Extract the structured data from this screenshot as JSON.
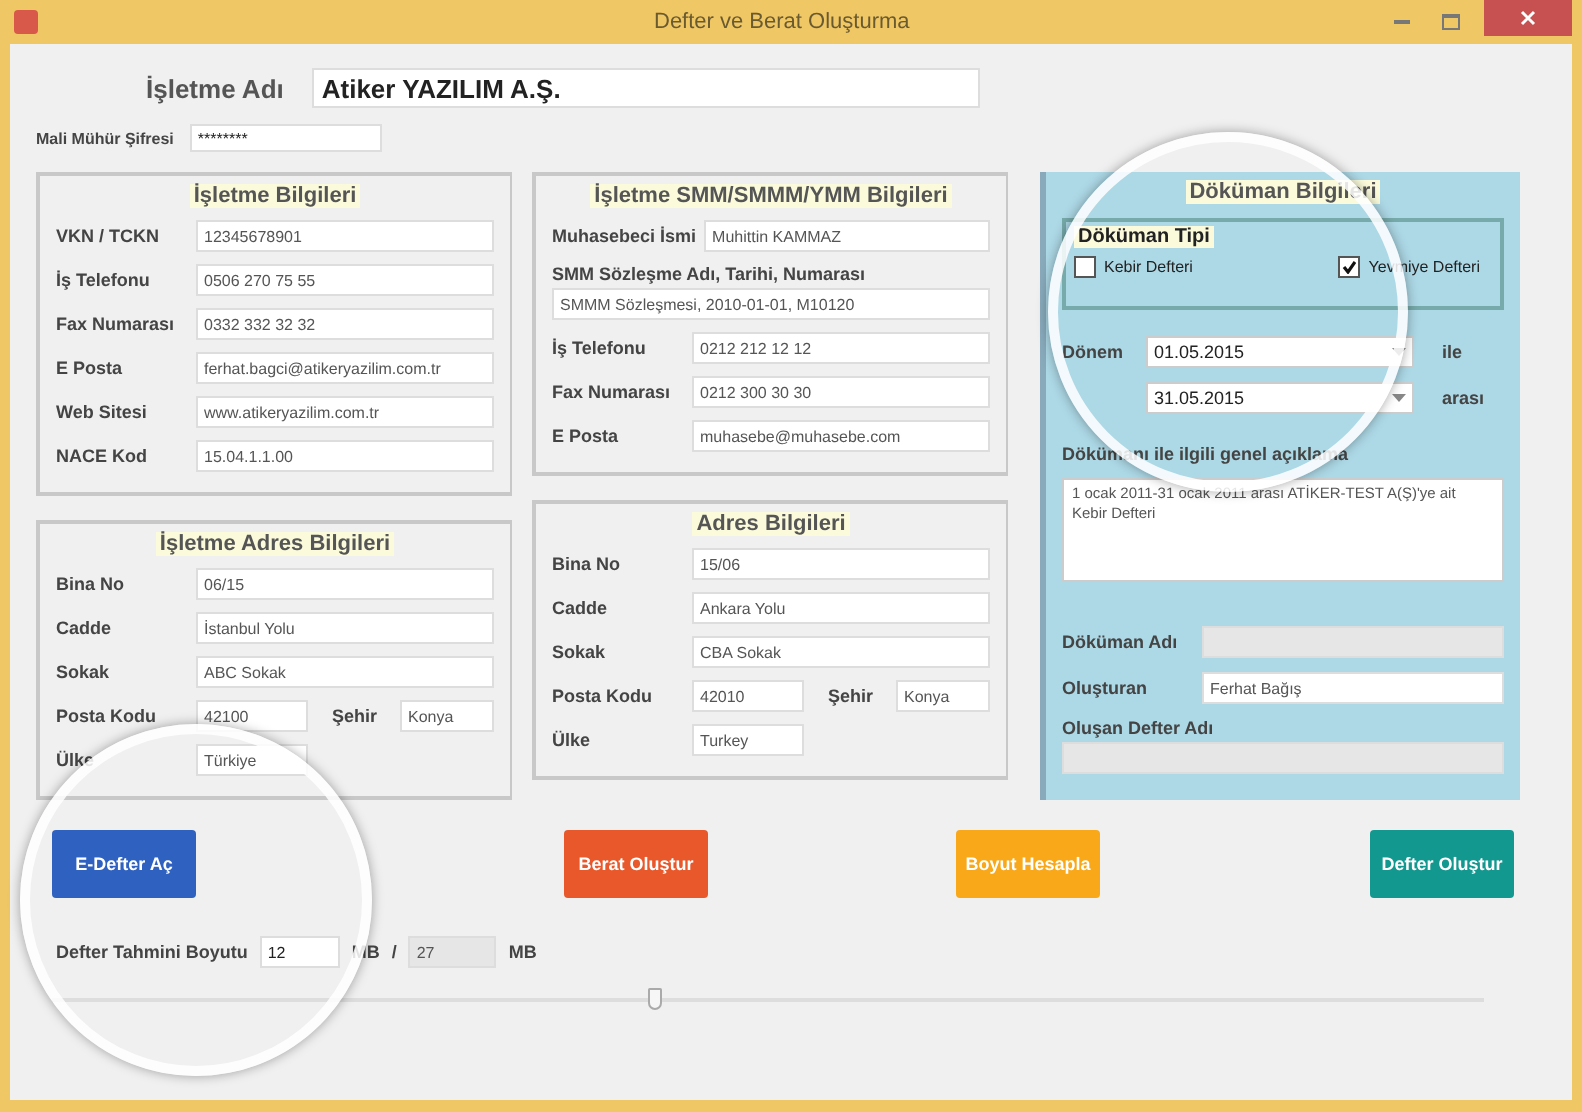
{
  "window": {
    "title": "Defter ve Berat Oluşturma"
  },
  "business_name": {
    "label": "İşletme Adı",
    "value": "Atiker YAZILIM A.Ş."
  },
  "seal_password": {
    "label": "Mali Mühür Şifresi",
    "value": "********"
  },
  "left_panels": [
    {
      "title": "İşletme Bilgileri",
      "fields": [
        {
          "kind": "inline",
          "label": "VKN / TCKN",
          "value": "12345678901"
        },
        {
          "kind": "inline",
          "label": "İş Telefonu",
          "value": "0506 270 75 55"
        },
        {
          "kind": "inline",
          "label": "Fax Numarası",
          "value": "0332 332 32 32"
        },
        {
          "kind": "inline",
          "label": "E Posta",
          "value": "ferhat.bagci@atikeryazilim.com.tr"
        },
        {
          "kind": "inline",
          "label": "Web Sitesi",
          "value": "www.atikeryazilim.com.tr"
        },
        {
          "kind": "inline",
          "label": "NACE Kod",
          "value": "15.04.1.1.00"
        }
      ]
    },
    {
      "title": "İşletme Adres Bilgileri",
      "fields": [
        {
          "kind": "inline",
          "label": "Bina No",
          "value": "06/15"
        },
        {
          "kind": "inline",
          "label": "Cadde",
          "value": "İstanbul Yolu"
        },
        {
          "kind": "inline",
          "label": "Sokak",
          "value": "ABC Sokak"
        },
        {
          "kind": "pair",
          "label": "Posta Kodu",
          "value": "42100",
          "label2": "Şehir",
          "value2": "Konya"
        },
        {
          "kind": "short",
          "label": "Ülke",
          "value": "Türkiye"
        }
      ]
    }
  ],
  "middle_panels": [
    {
      "title": "İşletme SMM/SMMM/YMM Bilgileri",
      "fields": [
        {
          "kind": "inline",
          "label": "Muhasebeci İsmi",
          "value": "Muhittin KAMMAZ"
        },
        {
          "kind": "stacked",
          "label": "SMM Sözleşme Adı, Tarihi, Numarası",
          "value": "SMMM Sözleşmesi, 2010-01-01, M10120"
        },
        {
          "kind": "inline",
          "label": "İş Telefonu",
          "value": "0212 212 12 12"
        },
        {
          "kind": "inline",
          "label": "Fax Numarası",
          "value": "0212 300 30 30"
        },
        {
          "kind": "inline",
          "label": "E Posta",
          "value": "muhasebe@muhasebe.com"
        }
      ]
    },
    {
      "title": "Adres Bilgileri",
      "fields": [
        {
          "kind": "inline",
          "label": "Bina No",
          "value": "15/06"
        },
        {
          "kind": "inline",
          "label": "Cadde",
          "value": "Ankara Yolu"
        },
        {
          "kind": "inline",
          "label": "Sokak",
          "value": "CBA Sokak"
        },
        {
          "kind": "pair",
          "label": "Posta Kodu",
          "value": "42010",
          "label2": "Şehir",
          "value2": "Konya"
        },
        {
          "kind": "short",
          "label": "Ülke",
          "value": "Turkey"
        }
      ]
    }
  ],
  "document_panel": {
    "title": "Döküman Bilgileri",
    "type_box": {
      "title": "Döküman Tipi",
      "options": [
        {
          "label": "Kebir Defteri",
          "checked": false
        },
        {
          "label": "Yevmiye Defteri",
          "checked": true
        }
      ]
    },
    "period": {
      "label": "Dönem",
      "start": "01.05.2015",
      "start_suffix": "ile",
      "end": "31.05.2015",
      "end_suffix": "arası"
    },
    "description": {
      "label": "Dökümanı ile ilgili genel açıklama",
      "value": "1 ocak 2011-31 ocak 2011 arası ATİKER-TEST A(Ş)'ye ait Kebir Defteri"
    },
    "fields": [
      {
        "kind": "inline",
        "label": "Döküman Adı",
        "disabled": true
      },
      {
        "kind": "inline",
        "label": "Oluşturan",
        "value": "Ferhat Bağış",
        "disabled": false
      },
      {
        "kind": "stacked",
        "label": "Oluşan Defter Adı",
        "disabled": true
      }
    ]
  },
  "buttons": [
    {
      "label": "E-Defter Aç",
      "color": "#2f62c0"
    },
    {
      "label": "Berat Oluştur",
      "color": "#e8582a"
    },
    {
      "label": "Boyut Hesapla",
      "color": "#f8a818"
    },
    {
      "label": "Defter Oluştur",
      "color": "#139890"
    }
  ],
  "size": {
    "label": "Defter Tahmini Boyutu",
    "value": "12",
    "unit": "MB",
    "separator": "/",
    "total": "27",
    "total_unit": "MB"
  },
  "slider": {
    "level": 0.42
  }
}
